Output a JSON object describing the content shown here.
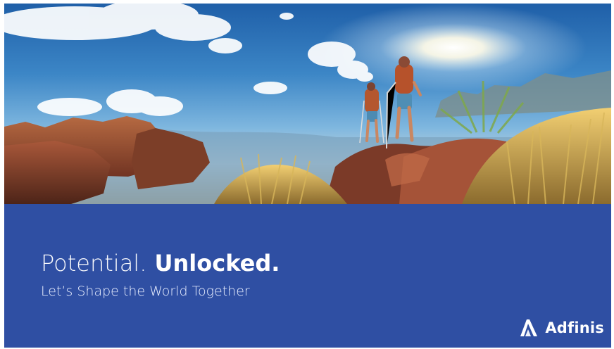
{
  "slide": {
    "headline_light": "Potential.",
    "headline_bold": "Unlocked.",
    "subtitle": "Let’s Shape the World Together",
    "brand_name": "Adfinis"
  },
  "colors": {
    "band": "#2f4fa3",
    "text": "#ffffff",
    "sky_top": "#1f5fa8",
    "rock": "#9b4e34",
    "grass": "#c7a24b"
  },
  "icons": {
    "brand": "adfinis-logo-icon"
  }
}
